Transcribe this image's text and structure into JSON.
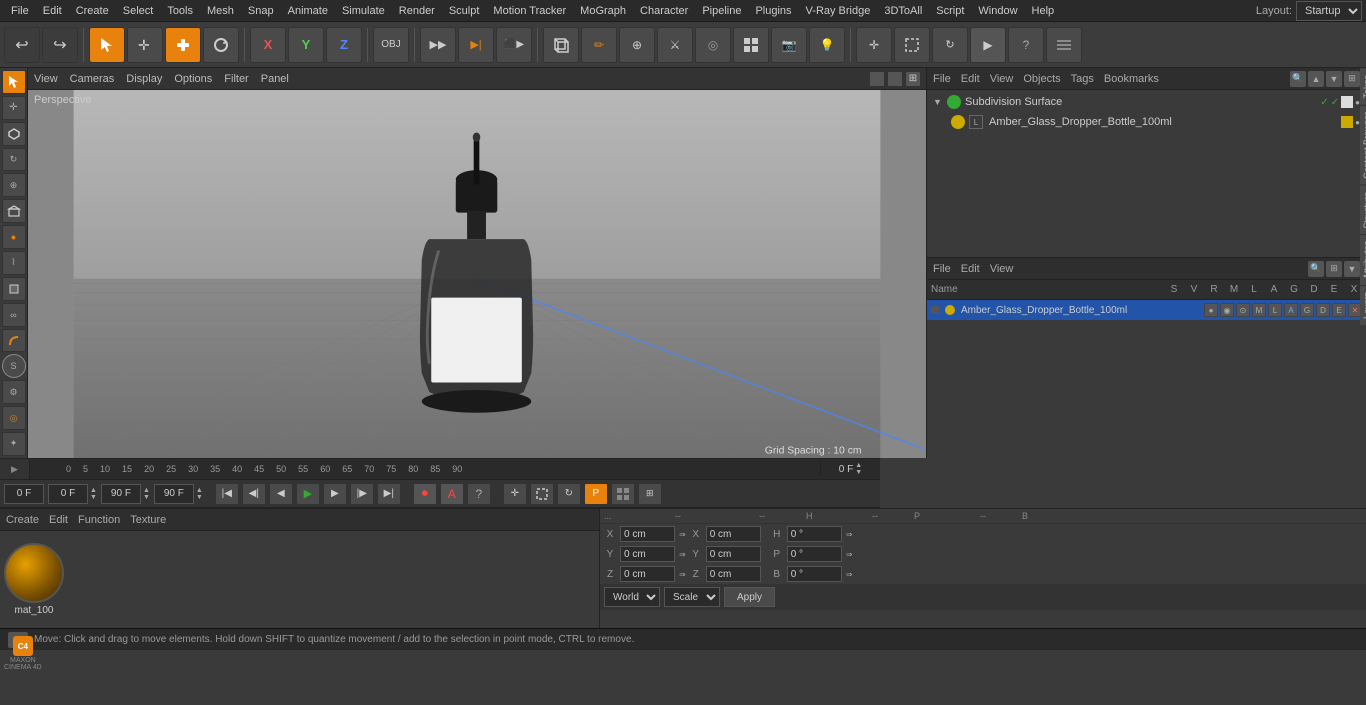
{
  "app": {
    "title": "Cinema 4D"
  },
  "top_menu": {
    "items": [
      "File",
      "Edit",
      "Create",
      "Select",
      "Tools",
      "Mesh",
      "Snap",
      "Animate",
      "Simulate",
      "Render",
      "Sculpt",
      "Motion Tracker",
      "MoGraph",
      "Character",
      "Pipeline",
      "Plugins",
      "V-Ray Bridge",
      "3DToAll",
      "Script",
      "Window",
      "Help"
    ]
  },
  "layout": {
    "label": "Layout:",
    "value": "Startup"
  },
  "toolbar": {
    "undo_label": "↩",
    "redo_label": "↪"
  },
  "viewport": {
    "perspective_label": "Perspective",
    "menu_items": [
      "View",
      "Cameras",
      "Display",
      "Options",
      "Filter",
      "Panel"
    ],
    "grid_spacing": "Grid Spacing : 10 cm"
  },
  "object_manager": {
    "menu_items": [
      "File",
      "Edit",
      "View",
      "Objects",
      "Tags",
      "Bookmarks"
    ],
    "objects": [
      {
        "name": "Subdivision Surface",
        "icon_color": "green",
        "checked": true,
        "indent": 0
      },
      {
        "name": "Amber_Glass_Dropper_Bottle_100ml",
        "icon_color": "yellow",
        "checked": false,
        "indent": 1
      }
    ]
  },
  "attributes_panel": {
    "menu_items": [
      "File",
      "Edit",
      "View"
    ],
    "columns": [
      "Name",
      "S",
      "V",
      "R",
      "M",
      "L",
      "A",
      "G",
      "D",
      "E",
      "X"
    ],
    "obj_name": "Amber_Glass_Dropper_Bottle_100ml",
    "obj_color": "yellow"
  },
  "timeline": {
    "ticks": [
      "0",
      "5",
      "10",
      "15",
      "20",
      "25",
      "30",
      "35",
      "40",
      "45",
      "50",
      "55",
      "60",
      "65",
      "70",
      "75",
      "80",
      "85",
      "90"
    ]
  },
  "playback": {
    "start_frame": "0 F",
    "prev_frame": "0 F",
    "current_frame": "90 F",
    "end_frame": "90 F",
    "frame_indicator": "0 F"
  },
  "material_panel": {
    "menu_items": [
      "Create",
      "Edit",
      "Function",
      "Texture"
    ],
    "material_name": "mat_100"
  },
  "coordinates": {
    "x_pos": "0 cm",
    "y_pos": "0 cm",
    "z_pos": "0 cm",
    "x_rot": "0 cm",
    "y_rot": "0 cm",
    "z_rot": "0 cm",
    "h_val": "0 °",
    "p_val": "0 °",
    "b_val": "0 °",
    "labels": {
      "x": "X",
      "y": "Y",
      "z": "Z",
      "h": "H",
      "p": "P",
      "b": "B"
    }
  },
  "bottom_bar": {
    "world_label": "World",
    "scale_label": "Scale",
    "apply_label": "Apply"
  },
  "status_bar": {
    "message": "Move: Click and drag to move elements. Hold down SHIFT to quantize movement / add to the selection in point mode, CTRL to remove."
  },
  "side_tabs": [
    "Takes",
    "Content Browser",
    "Structure",
    "Attributes",
    "Layers"
  ]
}
